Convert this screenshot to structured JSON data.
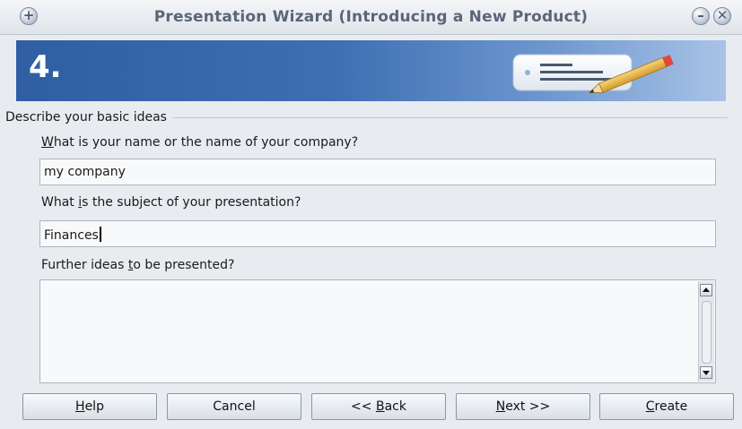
{
  "window": {
    "title": "Presentation Wizard (Introducing a New Product)",
    "plus_glyph": "+",
    "minimize_glyph": "–",
    "close_glyph": "✕"
  },
  "banner": {
    "step": "4.",
    "icon": "notepad-pencil-icon"
  },
  "form": {
    "group_label": "Describe your basic ideas",
    "name_label_mnemonic": "W",
    "name_label_rest": "hat is your name or the name of your company?",
    "name_value": "my company",
    "subject_label_pre": "What ",
    "subject_label_mnemonic": "i",
    "subject_label_post": "s the subject of your presentation?",
    "subject_value": "Finances",
    "ideas_label_pre": "Further ideas ",
    "ideas_label_mnemonic": "t",
    "ideas_label_post": "o be presented?",
    "ideas_value": ""
  },
  "buttons": {
    "help_mnemonic": "H",
    "help_rest": "elp",
    "cancel": "Cancel",
    "back_pre": "<< ",
    "back_mnemonic": "B",
    "back_rest": "ack",
    "next_mnemonic": "N",
    "next_rest": "ext >>",
    "create_mnemonic": "C",
    "create_rest": "reate"
  }
}
